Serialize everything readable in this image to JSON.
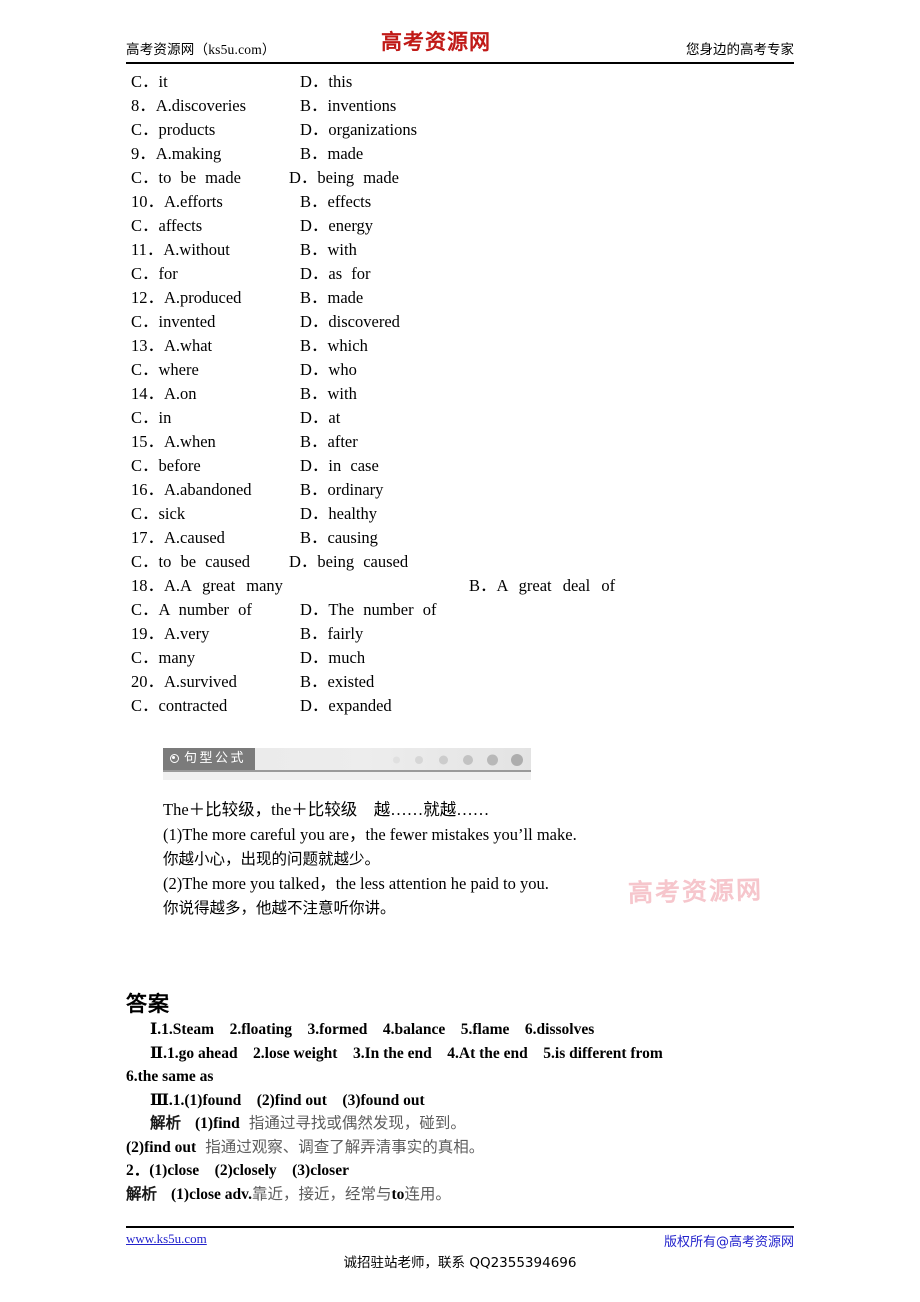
{
  "header": {
    "left": "高考资源网（ks5u.com）",
    "logo": "高考资源网",
    "right": "您身边的高考专家"
  },
  "options": {
    "rows": [
      {
        "a": "C．it",
        "b": "D．this"
      },
      {
        "a": "8．A.discoveries",
        "b": "B．inventions"
      },
      {
        "a": "C．products",
        "b": "D．organizations"
      },
      {
        "a": "9．A.making",
        "b": "B．made"
      },
      {
        "a": "C．to be made",
        "b": "D．being made"
      },
      {
        "a": "10．A.efforts",
        "b": "B．effects"
      },
      {
        "a": "C．affects",
        "b": "D．energy"
      },
      {
        "a": "11．A.without",
        "b": "B．with"
      },
      {
        "a": "C．for",
        "b": "D．as for"
      },
      {
        "a": "12．A.produced",
        "b": "B．made"
      },
      {
        "a": "C．invented",
        "b": "D．discovered"
      },
      {
        "a": "13．A.what",
        "b": "B．which"
      },
      {
        "a": "C．where",
        "b": "D．who"
      },
      {
        "a": "14．A.on",
        "b": "B．with"
      },
      {
        "a": "C．in",
        "b": "D．at"
      },
      {
        "a": "15．A.when",
        "b": "B．after"
      },
      {
        "a": "C．before",
        "b": "D．in case"
      },
      {
        "a": "16．A.abandoned",
        "b": "B．ordinary"
      },
      {
        "a": "C．sick",
        "b": "D．healthy"
      },
      {
        "a": "17．A.caused",
        "b": "B．causing"
      },
      {
        "a": "C．to be caused",
        "b": "D．being caused"
      },
      {
        "a": "18．A.A great many",
        "b": "B．A great deal of"
      },
      {
        "a": "C．A number of",
        "b": "D．The number of"
      },
      {
        "a": "19．A.very",
        "b": "B．fairly"
      },
      {
        "a": "C．many",
        "b": "D．much"
      },
      {
        "a": "20．A.survived",
        "b": "B．existed"
      },
      {
        "a": "C．contracted",
        "b": "D．expanded"
      }
    ]
  },
  "banner": {
    "label": "句型公式",
    "icon": "target-circle-icon"
  },
  "formula": {
    "title": "The＋比较级，the＋比较级　越……就越……",
    "example1_en": "(1)The more careful you are，the fewer mistakes you’ll make.",
    "example1_cn": "你越小心，出现的问题就越少。",
    "example2_en": "(2)The more you talked，the less attention he paid to you.",
    "example2_cn": "你说得越多，他越不注意听你讲。"
  },
  "watermark": "高考资源网",
  "answers": {
    "title": "答案",
    "section1": "Ⅰ.1.Steam　2.floating　3.formed　4.balance　5.flame　6.dissolves",
    "section2": "Ⅱ.1.go ahead　2.lose weight　3.In the end　4.At the end　5.is different from",
    "section2_cont": "6.the same as",
    "section3": "Ⅲ.1.(1)found　(2)find out　(3)found out",
    "note1_label": "解析",
    "note1_bold": "(1)find",
    "note1_text": "指通过寻找或偶然发现，碰到。",
    "note2_bold": "(2)find out",
    "note2_text": "指通过观察、调查了解弄清事实的真相。",
    "item2": "2．(1)close　(2)closely　(3)closer",
    "note3_label": "解析",
    "note3_bold": "(1)close adv.",
    "note3_text_a": "靠近，接近，经常与",
    "note3_bold_b": "to",
    "note3_text_b": "连用。"
  },
  "footer": {
    "left": "www.ks5u.com",
    "center": "诚招驻站老师，联系 QQ2355394696",
    "right": "版权所有@高考资源网"
  },
  "colors": {
    "logo_red": "#c01a17",
    "link_blue": "#2222cc",
    "watermark_pink": "#f6c3ca",
    "banner_tag_gray": "#7b7b7b",
    "banner_bg_gray": "#ebebeb"
  }
}
